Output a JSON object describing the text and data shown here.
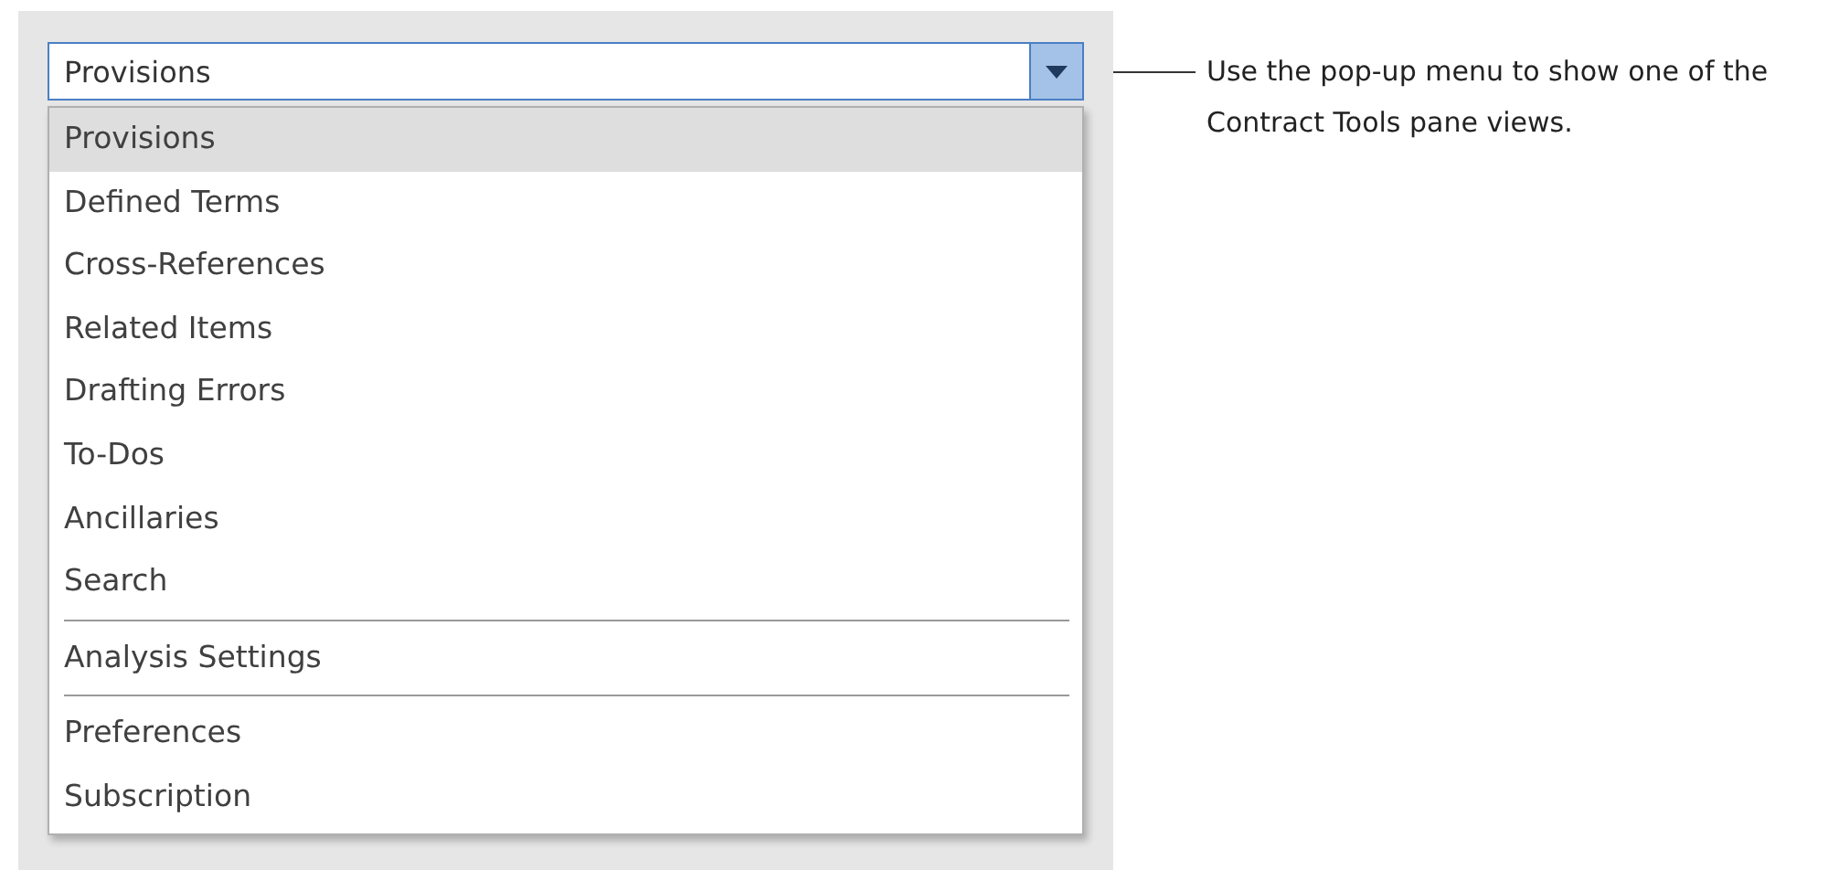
{
  "dropdown": {
    "value": "Provisions",
    "expanded": true
  },
  "menu": [
    {
      "kind": "item",
      "label": "Provisions",
      "selected": true
    },
    {
      "kind": "item",
      "label": "Defined Terms",
      "selected": false
    },
    {
      "kind": "item",
      "label": "Cross-References",
      "selected": false
    },
    {
      "kind": "item",
      "label": "Related Items",
      "selected": false
    },
    {
      "kind": "item",
      "label": "Drafting Errors",
      "selected": false
    },
    {
      "kind": "item",
      "label": "To-Dos",
      "selected": false
    },
    {
      "kind": "item",
      "label": "Ancillaries",
      "selected": false
    },
    {
      "kind": "item",
      "label": "Search",
      "selected": false
    },
    {
      "kind": "separator"
    },
    {
      "kind": "item",
      "label": "Analysis Settings",
      "selected": false
    },
    {
      "kind": "separator"
    },
    {
      "kind": "item",
      "label": "Preferences",
      "selected": false
    },
    {
      "kind": "item",
      "label": "Subscription",
      "selected": false
    }
  ],
  "callout": {
    "text": "Use the pop-up menu to show one of the Contract Tools pane views."
  }
}
